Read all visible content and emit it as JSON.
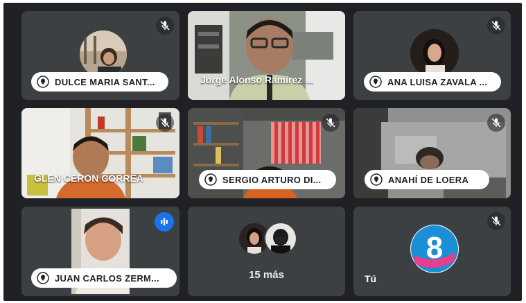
{
  "participants": [
    {
      "name": "DULCE MARIA SANT...",
      "muted": true
    },
    {
      "name": "Jorge Alonso Ramirez ...",
      "muted": false
    },
    {
      "name": "ANA LUISA ZAVALA ...",
      "muted": true
    },
    {
      "name": "GLEN CERON CORREA",
      "muted": true
    },
    {
      "name": "SERGIO ARTURO DI...",
      "muted": true
    },
    {
      "name": "ANAHÍ DE LOERA",
      "muted": true
    },
    {
      "name": "JUAN CARLOS ZERM...",
      "muted": false,
      "speaking": true
    }
  ],
  "overflow": {
    "label": "15 más"
  },
  "self": {
    "label": "Tú",
    "logo_text": "8"
  },
  "colors": {
    "accent": "#1a73e8",
    "tile_bg": "#3c4043",
    "stage_bg": "#202124"
  },
  "icons": {
    "mute": "mic-off-icon",
    "pin": "pin-icon",
    "speaking": "audio-level-icon"
  }
}
